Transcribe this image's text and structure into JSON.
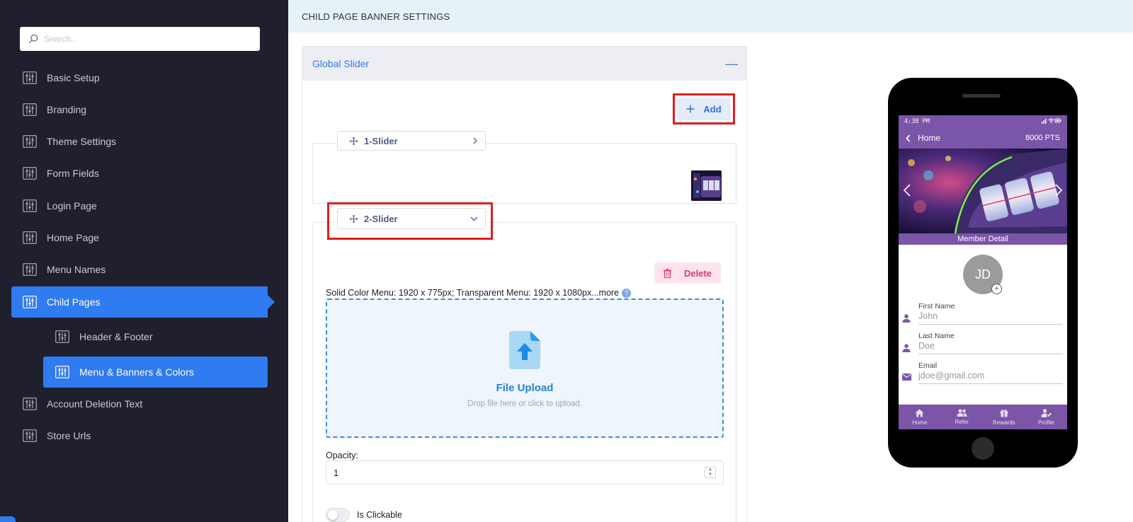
{
  "sidebar": {
    "search_placeholder": "Search...",
    "items": [
      {
        "label": "Basic Setup"
      },
      {
        "label": "Branding"
      },
      {
        "label": "Theme Settings"
      },
      {
        "label": "Form Fields"
      },
      {
        "label": "Login Page"
      },
      {
        "label": "Home Page"
      },
      {
        "label": "Menu Names"
      },
      {
        "label": "Child Pages"
      },
      {
        "label": "Header & Footer"
      },
      {
        "label": "Menu & Banners & Colors"
      },
      {
        "label": "Account Deletion Text"
      },
      {
        "label": "Store Urls"
      }
    ],
    "active_item": "Child Pages",
    "active_subitem": "Menu & Banners & Colors"
  },
  "header": {
    "title": "CHILD PAGE BANNER SETTINGS"
  },
  "panel": {
    "title": "Global Slider",
    "collapse_symbol": "—",
    "add_label": "Add",
    "sliders": [
      {
        "label": "1-Slider",
        "expanded": false
      },
      {
        "label": "2-Slider",
        "expanded": true
      }
    ],
    "delete_label": "Delete",
    "size_hint": "Solid Color Menu: 1920 x 775px; Transparent Menu: 1920 x 1080px...more",
    "help_symbol": "?",
    "upload_title": "File Upload",
    "upload_subtitle": "Drop file here or click to upload.",
    "opacity_label": "Opacity:",
    "opacity_value": "1",
    "clickable_label": "Is Clickable",
    "clickable_on": false
  },
  "phone": {
    "time": "4:38 PM",
    "back_label": "Home",
    "points": "8000 PTS",
    "section_title": "Member Detail",
    "avatar_initials": "JD",
    "fields": [
      {
        "label": "First Name",
        "value": "John",
        "icon": "person-icon"
      },
      {
        "label": "Last Name",
        "value": "Doe",
        "icon": "person-icon"
      },
      {
        "label": "Email",
        "value": "jdoe@gmail.com",
        "icon": "mail-icon"
      }
    ],
    "tabs": [
      {
        "label": "Home",
        "icon": "home-icon"
      },
      {
        "label": "Refer",
        "icon": "people-icon"
      },
      {
        "label": "Rewards",
        "icon": "gift-icon"
      },
      {
        "label": "Profile",
        "icon": "profile-edit-icon"
      }
    ]
  },
  "colors": {
    "sidebar_bg": "#1f1f2e",
    "accent": "#2f7bf0",
    "highlight_outline": "#e01d1d",
    "phone_theme": "#7b55a8",
    "delete": "#e0376b"
  }
}
